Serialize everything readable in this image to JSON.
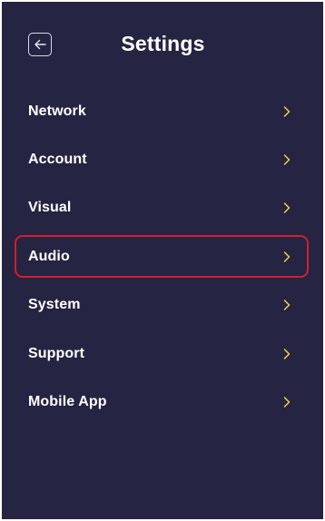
{
  "header": {
    "title": "Settings",
    "back_icon": "arrow-left-icon"
  },
  "menu": {
    "items": [
      {
        "id": "network",
        "label": "Network",
        "icon": "chevron-right-icon",
        "selected": false
      },
      {
        "id": "account",
        "label": "Account",
        "icon": "chevron-right-icon",
        "selected": false
      },
      {
        "id": "visual",
        "label": "Visual",
        "icon": "chevron-right-icon",
        "selected": false
      },
      {
        "id": "audio",
        "label": "Audio",
        "icon": "chevron-right-icon",
        "selected": true
      },
      {
        "id": "system",
        "label": "System",
        "icon": "chevron-right-icon",
        "selected": false
      },
      {
        "id": "support",
        "label": "Support",
        "icon": "chevron-right-icon",
        "selected": false
      },
      {
        "id": "mobile-app",
        "label": "Mobile App",
        "icon": "chevron-right-icon",
        "selected": false
      }
    ]
  },
  "colors": {
    "background": "#252442",
    "text": "#ffffff",
    "chevron": "#f3d23a",
    "selection_border": "#d11f2b"
  }
}
